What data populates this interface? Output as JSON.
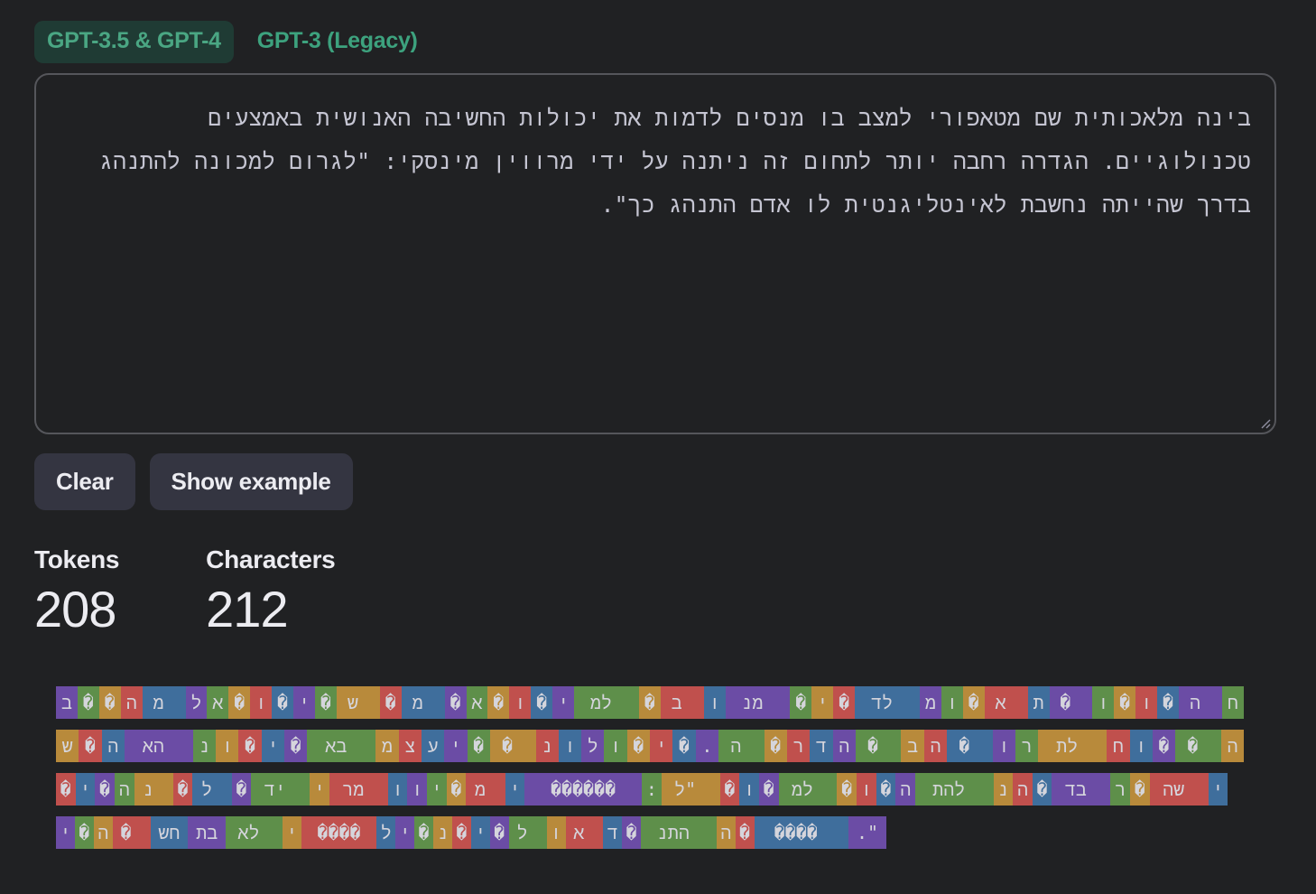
{
  "tabs": [
    {
      "label": "GPT-3.5 & GPT-4",
      "active": true
    },
    {
      "label": "GPT-3 (Legacy)",
      "active": false
    }
  ],
  "editor": {
    "text": "בינה מלאכותית שם מטאפורי למצב בו מנסים לדמות את יכולות החשיבה האנושית באמצעים טכנולוגיים. הגדרה רחבה יותר לתחום זה ניתנה על ידי מרווין מינסקי: \"לגרום למכונה להתנהג בדרך שהייתה נחשבת לאינטליגנטית לו אדם התנהג כך\"."
  },
  "buttons": {
    "clear": "Clear",
    "show_example": "Show example"
  },
  "stats": {
    "tokens_label": "Tokens",
    "tokens_value": "208",
    "characters_label": "Characters",
    "characters_value": "212"
  },
  "token_colors": [
    "#6b4ca5",
    "#5e8f4a",
    "#b88a3b",
    "#c0504d",
    "#3f6e9c"
  ],
  "token_lines": [
    [
      {
        "t": "ב",
        "c": 0
      },
      {
        "t": "�",
        "c": 1
      },
      {
        "t": "�",
        "c": 2
      },
      {
        "t": "ה",
        "c": 3
      },
      {
        "t": " מ",
        "c": 4
      },
      {
        "t": "ל",
        "c": 0
      },
      {
        "t": "א",
        "c": 1
      },
      {
        "t": "�",
        "c": 2
      },
      {
        "t": "ו",
        "c": 3
      },
      {
        "t": "�",
        "c": 4
      },
      {
        "t": "י",
        "c": 0
      },
      {
        "t": "�",
        "c": 1
      },
      {
        "t": " ש",
        "c": 2
      },
      {
        "t": "�",
        "c": 3
      },
      {
        "t": " מ",
        "c": 4
      },
      {
        "t": "�",
        "c": 0
      },
      {
        "t": "א",
        "c": 1
      },
      {
        "t": "�",
        "c": 2
      },
      {
        "t": "ו",
        "c": 3
      },
      {
        "t": "�",
        "c": 4
      },
      {
        "t": "י",
        "c": 0
      },
      {
        "t": " למ",
        "c": 1
      },
      {
        "t": "�",
        "c": 2
      },
      {
        "t": " ב",
        "c": 3
      },
      {
        "t": "ו",
        "c": 4
      },
      {
        "t": " מנ",
        "c": 0
      },
      {
        "t": "�",
        "c": 1
      },
      {
        "t": "י",
        "c": 2
      },
      {
        "t": "�",
        "c": 3
      },
      {
        "t": " לד",
        "c": 4
      },
      {
        "t": "מ",
        "c": 0
      },
      {
        "t": "ו",
        "c": 1
      },
      {
        "t": "�",
        "c": 2
      },
      {
        "t": " א",
        "c": 3
      },
      {
        "t": "ת",
        "c": 4
      },
      {
        "t": " �",
        "c": 0
      },
      {
        "t": "ו",
        "c": 1
      },
      {
        "t": "�",
        "c": 2
      },
      {
        "t": "ו",
        "c": 3
      },
      {
        "t": "�",
        "c": 4
      },
      {
        "t": " ה",
        "c": 0
      },
      {
        "t": "ח",
        "c": 1
      }
    ],
    [
      {
        "t": "ש",
        "c": 2
      },
      {
        "t": "�",
        "c": 3
      },
      {
        "t": "ה",
        "c": 4
      },
      {
        "t": " הא",
        "c": 0
      },
      {
        "t": "נ",
        "c": 1
      },
      {
        "t": "ו",
        "c": 2
      },
      {
        "t": "�",
        "c": 3
      },
      {
        "t": "י",
        "c": 4
      },
      {
        "t": "�",
        "c": 0
      },
      {
        "t": " בא",
        "c": 1
      },
      {
        "t": "מ",
        "c": 2
      },
      {
        "t": "צ",
        "c": 3
      },
      {
        "t": "ע",
        "c": 4
      },
      {
        "t": "י",
        "c": 0
      },
      {
        "t": "�",
        "c": 1
      },
      {
        "t": " �",
        "c": 2
      },
      {
        "t": "נ",
        "c": 3
      },
      {
        "t": "ו",
        "c": 4
      },
      {
        "t": "ל",
        "c": 0
      },
      {
        "t": "ו",
        "c": 1
      },
      {
        "t": "�",
        "c": 2
      },
      {
        "t": "י",
        "c": 3
      },
      {
        "t": "�",
        "c": 4
      },
      {
        "t": ".",
        "c": 0
      },
      {
        "t": " ה",
        "c": 1
      },
      {
        "t": "�",
        "c": 2
      },
      {
        "t": "ר",
        "c": 3
      },
      {
        "t": "ד",
        "c": 4
      },
      {
        "t": "ה",
        "c": 0
      },
      {
        "t": " �",
        "c": 1
      },
      {
        "t": "ב",
        "c": 2
      },
      {
        "t": "ה",
        "c": 3
      },
      {
        "t": " �",
        "c": 4
      },
      {
        "t": "ו",
        "c": 0
      },
      {
        "t": "ר",
        "c": 1
      },
      {
        "t": " לת",
        "c": 2
      },
      {
        "t": "ח",
        "c": 3
      },
      {
        "t": "ו",
        "c": 4
      },
      {
        "t": "�",
        "c": 0
      },
      {
        "t": " �",
        "c": 1
      },
      {
        "t": "ה",
        "c": 2
      }
    ],
    [
      {
        "t": "�",
        "c": 3
      },
      {
        "t": "י",
        "c": 4
      },
      {
        "t": "�",
        "c": 0
      },
      {
        "t": "ה",
        "c": 1
      },
      {
        "t": " נ",
        "c": 2
      },
      {
        "t": "�",
        "c": 3
      },
      {
        "t": " ל",
        "c": 4
      },
      {
        "t": "�",
        "c": 0
      },
      {
        "t": " יד",
        "c": 1
      },
      {
        "t": "י",
        "c": 2
      },
      {
        "t": " מר",
        "c": 3
      },
      {
        "t": "ו",
        "c": 4
      },
      {
        "t": "ו",
        "c": 0
      },
      {
        "t": "י",
        "c": 1
      },
      {
        "t": "�",
        "c": 2
      },
      {
        "t": " מ",
        "c": 3
      },
      {
        "t": "י",
        "c": 4
      },
      {
        "t": "������",
        "c": 0
      },
      {
        "t": ":",
        "c": 1
      },
      {
        "t": " \"ל",
        "c": 2
      },
      {
        "t": "�",
        "c": 3
      },
      {
        "t": "ו",
        "c": 4
      },
      {
        "t": "�",
        "c": 0
      },
      {
        "t": " למ",
        "c": 1
      },
      {
        "t": "�",
        "c": 2
      },
      {
        "t": "ו",
        "c": 3
      },
      {
        "t": "�",
        "c": 4
      },
      {
        "t": "ה",
        "c": 0
      },
      {
        "t": " להת",
        "c": 1
      },
      {
        "t": "נ",
        "c": 2
      },
      {
        "t": "ה",
        "c": 3
      },
      {
        "t": "�",
        "c": 4
      },
      {
        "t": " בד",
        "c": 0
      },
      {
        "t": "ר",
        "c": 1
      },
      {
        "t": "�",
        "c": 2
      },
      {
        "t": " שה",
        "c": 3
      },
      {
        "t": "י",
        "c": 4
      }
    ],
    [
      {
        "t": "י",
        "c": 0
      },
      {
        "t": "�",
        "c": 1
      },
      {
        "t": "ה",
        "c": 2
      },
      {
        "t": " �",
        "c": 3
      },
      {
        "t": "חש",
        "c": 4
      },
      {
        "t": "בת",
        "c": 0
      },
      {
        "t": " לא",
        "c": 1
      },
      {
        "t": "י",
        "c": 2
      },
      {
        "t": "����",
        "c": 3
      },
      {
        "t": "ל",
        "c": 4
      },
      {
        "t": "י",
        "c": 0
      },
      {
        "t": "�",
        "c": 1
      },
      {
        "t": "נ",
        "c": 2
      },
      {
        "t": "�",
        "c": 3
      },
      {
        "t": "י",
        "c": 4
      },
      {
        "t": "�",
        "c": 0
      },
      {
        "t": " ל",
        "c": 1
      },
      {
        "t": "ו",
        "c": 2
      },
      {
        "t": " א",
        "c": 3
      },
      {
        "t": "ד",
        "c": 4
      },
      {
        "t": "�",
        "c": 0
      },
      {
        "t": " התנ",
        "c": 1
      },
      {
        "t": "ה",
        "c": 2
      },
      {
        "t": "�",
        "c": 3
      },
      {
        "t": " ����",
        "c": 4
      },
      {
        "t": "\".",
        "c": 0
      }
    ]
  ]
}
